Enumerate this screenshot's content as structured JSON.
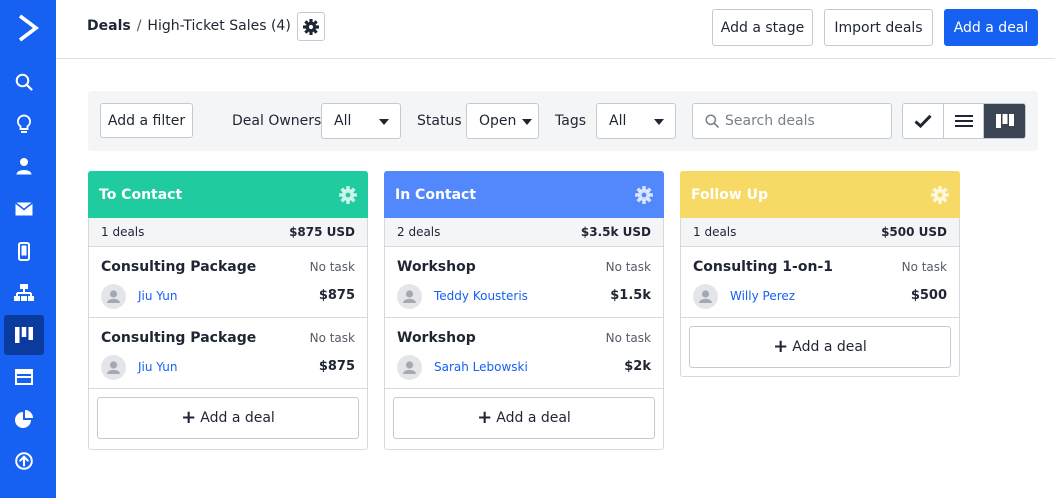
{
  "header": {
    "breadcrumb_root": "Deals",
    "breadcrumb_sep": "/",
    "pipeline_name": "High-Ticket Sales (4)",
    "add_stage_label": "Add a stage",
    "import_label": "Import deals",
    "add_deal_label": "Add a deal"
  },
  "sidebar": {
    "items": [
      {
        "icon": "search-icon"
      },
      {
        "icon": "lightbulb-icon"
      },
      {
        "icon": "contact-icon"
      },
      {
        "icon": "mail-icon"
      },
      {
        "icon": "mobile-icon"
      },
      {
        "icon": "automation-icon"
      },
      {
        "icon": "deals-pipeline-icon",
        "active": true
      },
      {
        "icon": "website-icon"
      },
      {
        "icon": "reports-icon"
      },
      {
        "icon": "upgrade-icon"
      }
    ]
  },
  "filters": {
    "add_filter_label": "Add a filter",
    "owners_label": "Deal Owners",
    "owners_value": "All",
    "status_label": "Status",
    "status_value": "Open",
    "tags_label": "Tags",
    "tags_value": "All",
    "search_placeholder": "Search deals"
  },
  "colors": {
    "brand": "#1660f2",
    "to_contact": "#1fcb9f",
    "in_contact": "#5288fb",
    "follow_up": "#f7d965"
  },
  "columns": [
    {
      "title": "To Contact",
      "count": "1 deals",
      "total": "$875 USD",
      "deals": [
        {
          "name": "Consulting Package",
          "task": "No task",
          "owner": "Jiu Yun",
          "value": "$875"
        },
        {
          "name": "Consulting Package",
          "task": "No task",
          "owner": "Jiu Yun",
          "value": "$875"
        }
      ],
      "add_label": "Add a deal"
    },
    {
      "title": "In Contact",
      "count": "2 deals",
      "total": "$3.5k USD",
      "deals": [
        {
          "name": "Workshop",
          "task": "No task",
          "owner": "Teddy Kousteris",
          "value": "$1.5k"
        },
        {
          "name": "Workshop",
          "task": "No task",
          "owner": "Sarah Lebowski",
          "value": "$2k"
        }
      ],
      "add_label": "Add a deal"
    },
    {
      "title": "Follow Up",
      "count": "1 deals",
      "total": "$500 USD",
      "deals": [
        {
          "name": "Consulting 1-on-1",
          "task": "No task",
          "owner": "Willy Perez",
          "value": "$500"
        }
      ],
      "add_label": "Add a deal"
    }
  ]
}
